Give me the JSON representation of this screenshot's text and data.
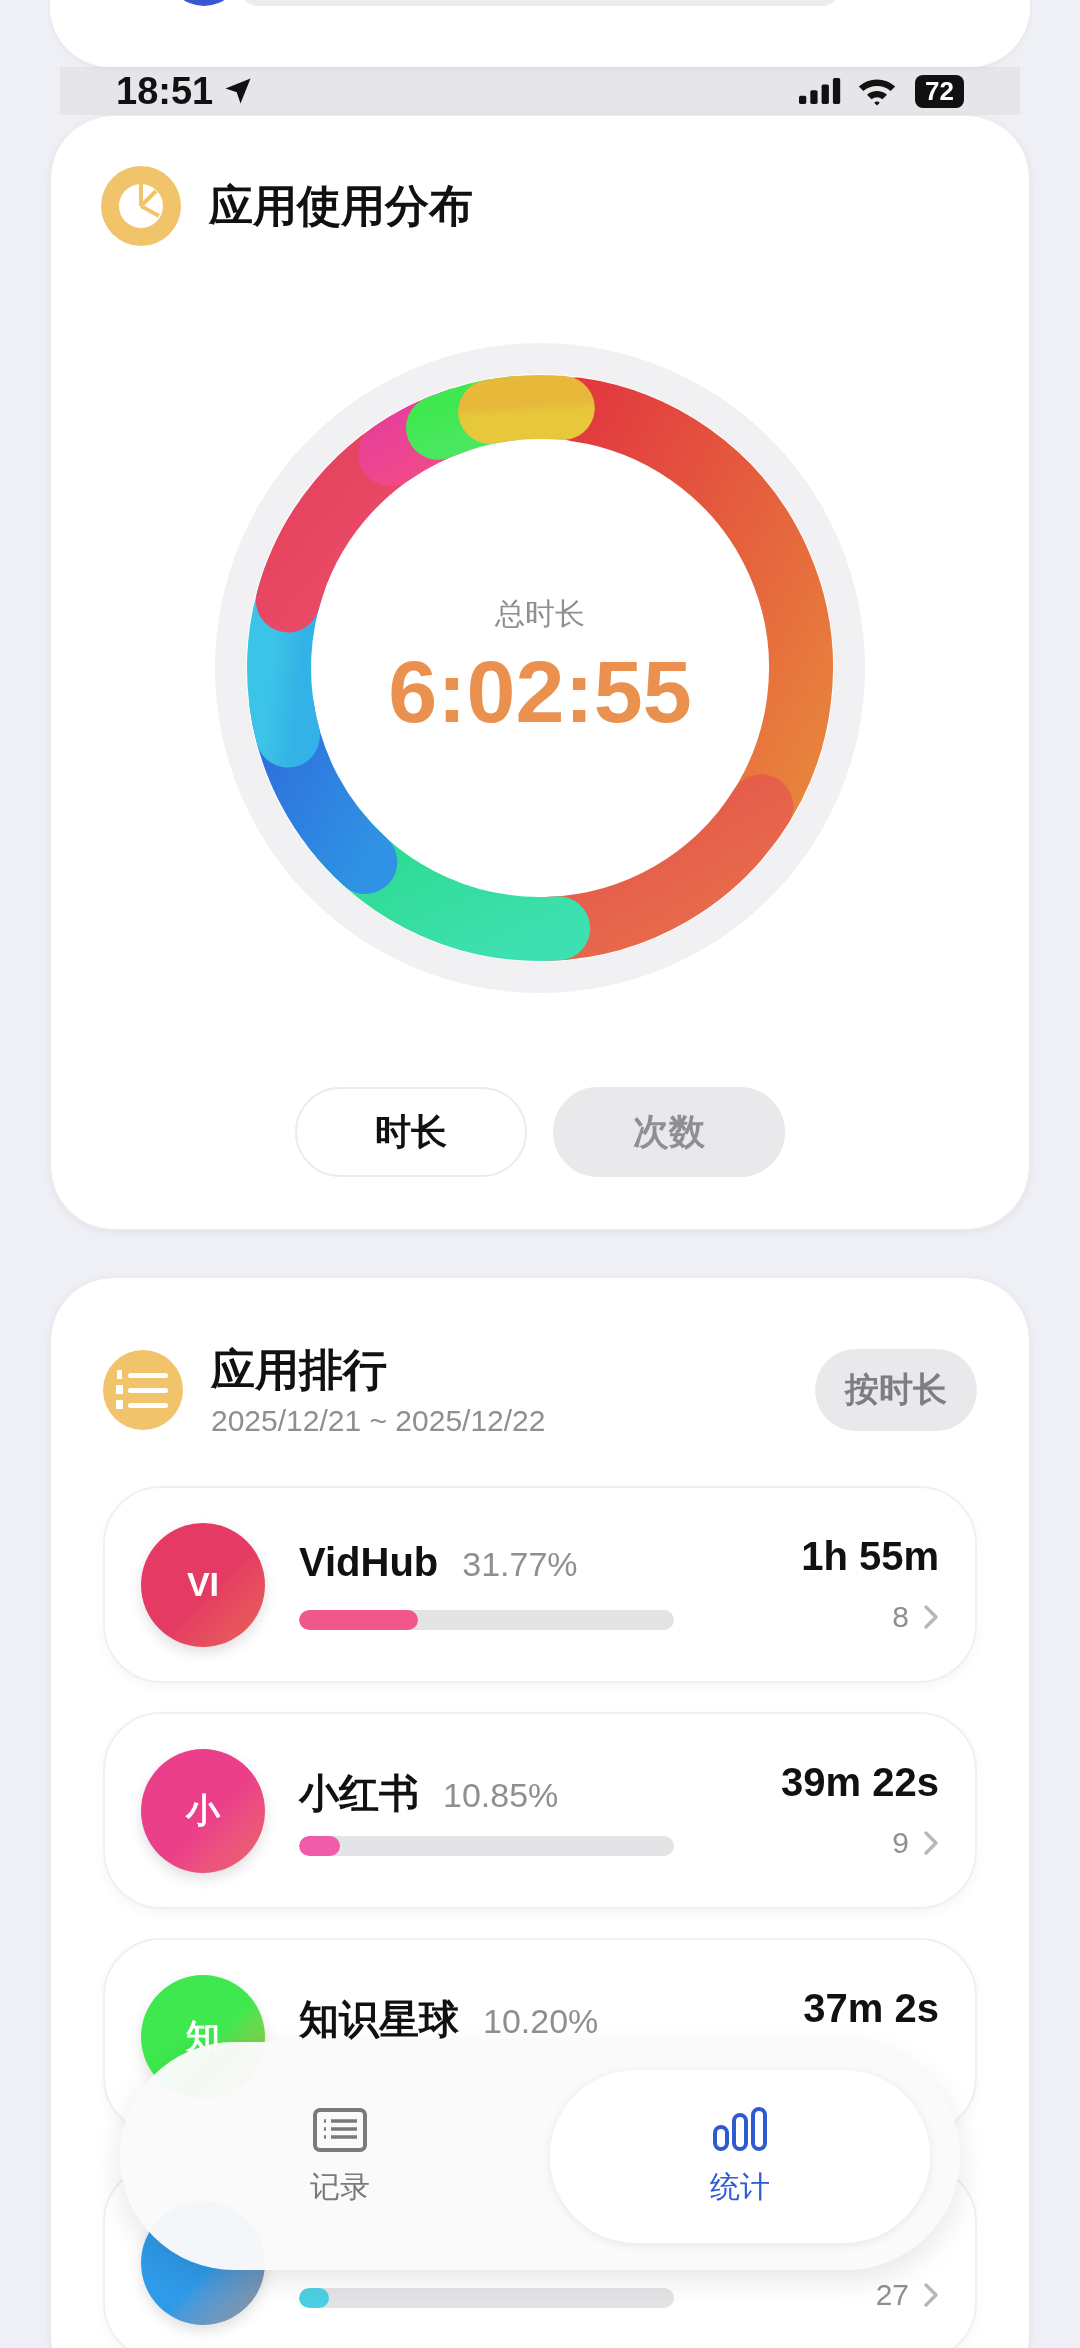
{
  "status_bar": {
    "time": "18:51",
    "battery": "72"
  },
  "usage_card": {
    "title": "应用使用分布",
    "total_label": "总时长",
    "total_value": "6:02:55",
    "toggle": [
      {
        "label": "时长",
        "selected": true
      },
      {
        "label": "次数",
        "selected": false
      }
    ]
  },
  "ranking_card": {
    "title": "应用排行",
    "date_range": "2025/12/21 ~ 2025/12/22",
    "sort_button": "按时长",
    "apps": [
      {
        "initial": "VI",
        "name": "VidHub",
        "percent": "31.77%",
        "duration": "1h 55m",
        "count": "8",
        "level": 0.3177,
        "color": "#f0588c",
        "avatar": {
          "color": "#e53a63"
        }
      },
      {
        "initial": "小",
        "name": "小红书",
        "percent": "10.85%",
        "duration": "39m 22s",
        "count": "9",
        "level": 0.1085,
        "color": "#f25aaa",
        "avatar": {
          "color": "#ec3f8a"
        }
      },
      {
        "initial": "知",
        "name": "知识星球",
        "percent": "10.20%",
        "duration": "37m 2s",
        "avatar": {
          "color": "#3ee84e"
        }
      },
      {
        "count": "27",
        "level": 0.079,
        "color": "#4ccfe2",
        "avatar": {
          "color": "#2f9ae8"
        }
      }
    ]
  },
  "tab_bar": [
    {
      "label": "记录",
      "selected": false,
      "kind": "list"
    },
    {
      "label": "统计",
      "selected": true,
      "kind": "chart"
    }
  ]
}
